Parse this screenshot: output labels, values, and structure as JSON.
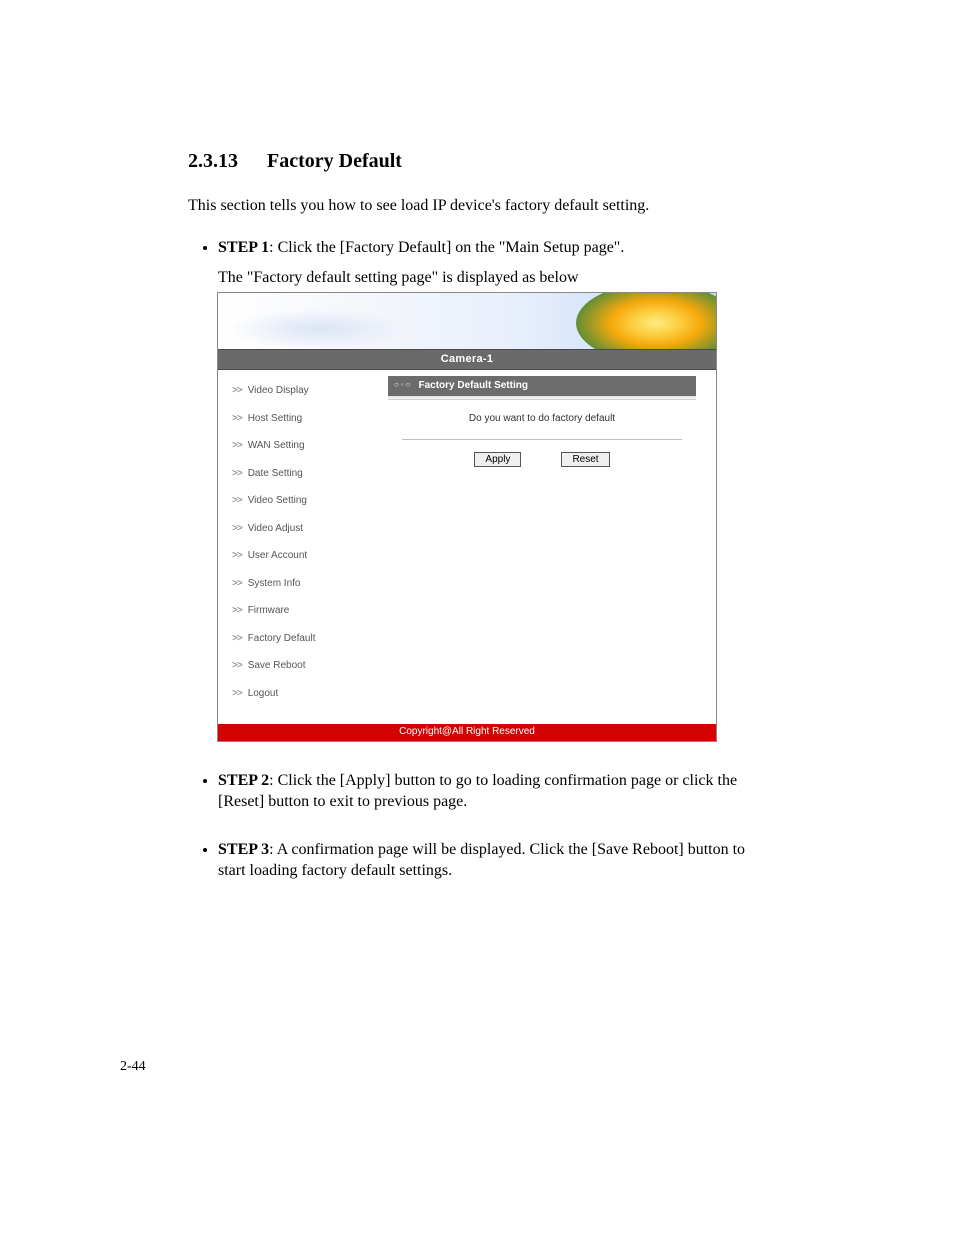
{
  "heading": {
    "number": "2.3.13",
    "title": "Factory Default"
  },
  "intro": "This section tells you how to see load IP device's factory default setting.",
  "steps": {
    "s1": {
      "label": "STEP 1",
      "text": ": Click the [Factory Default] on the \"Main Setup page\"."
    },
    "s1_sub": "The \"Factory default setting page\" is displayed as below",
    "s2": {
      "label": "STEP 2",
      "text": ": Click the [Apply] button to go to loading confirmation page or click the [Reset] button to exit to previous page."
    },
    "s3": {
      "label": "STEP 3",
      "text": ": A confirmation page will be displayed. Click the [Save Reboot] button to start loading factory default settings."
    }
  },
  "screenshot": {
    "title_bar": "Camera-1",
    "sidebar": [
      "Video Display",
      "Host Setting",
      "WAN Setting",
      "Date Setting",
      "Video Setting",
      "Video Adjust",
      "User Account",
      "System Info",
      "Firmware",
      "Factory Default",
      "Save Reboot",
      "Logout"
    ],
    "panel_title": "Factory Default Setting",
    "prompt": "Do you want to do factory default",
    "apply": "Apply",
    "reset": "Reset",
    "footer": "Copyright@All Right Reserved"
  },
  "page_number": "2-44"
}
